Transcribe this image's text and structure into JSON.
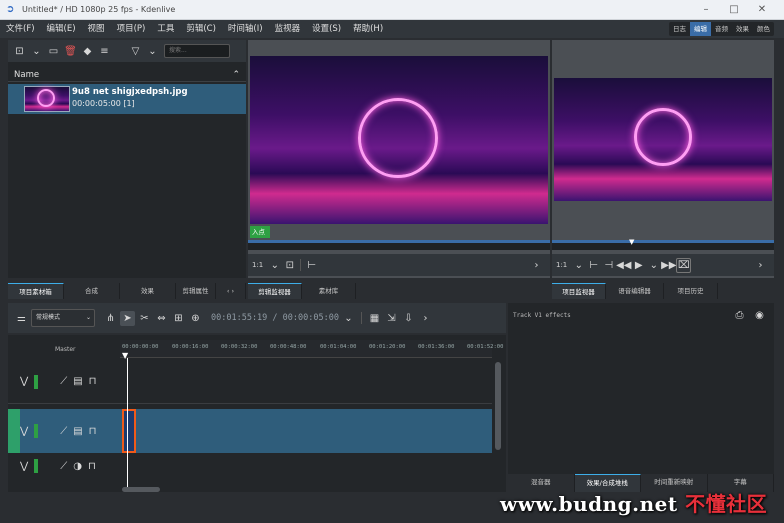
{
  "window": {
    "title": "Untitled* / HD 1080p 25 fps - Kdenlive",
    "minimize": "–",
    "maximize": "□",
    "close": "✕"
  },
  "menu": [
    "文件(F)",
    "编辑(E)",
    "视图",
    "项目(P)",
    "工具",
    "剪辑(C)",
    "时间轴(I)",
    "监视器",
    "设置(S)",
    "帮助(H)"
  ],
  "layouts": [
    {
      "label": "日志",
      "active": false
    },
    {
      "label": "编辑",
      "active": true
    },
    {
      "label": "音频",
      "active": false
    },
    {
      "label": "效果",
      "active": false
    },
    {
      "label": "颜色",
      "active": false
    }
  ],
  "bin": {
    "search_placeholder": "搜索...",
    "column_header": "Name",
    "clip": {
      "name": "9u8 net shigjxedpsh.jpg",
      "info": "00:00:05:00 [1]"
    }
  },
  "bin_tabs": [
    {
      "label": "项目素材箱",
      "active": true
    },
    {
      "label": "合成",
      "active": false
    },
    {
      "label": "效果",
      "active": false
    },
    {
      "label": "剪辑属性",
      "active": false
    }
  ],
  "clip_monitor": {
    "in_point": "入点",
    "zoom": "1:1"
  },
  "mid_tabs": [
    {
      "label": "剪辑监视器",
      "active": true
    },
    {
      "label": "素材库",
      "active": false
    }
  ],
  "project_monitor": {
    "zoom": "1:1"
  },
  "right_tabs": [
    {
      "label": "项目监视器",
      "active": true
    },
    {
      "label": "语音编辑器",
      "active": false
    },
    {
      "label": "项目历史",
      "active": false
    }
  ],
  "timeline": {
    "mode": "常规模式",
    "timecode": "00:01:55:19 / 00:00:05:00",
    "master": "Master",
    "ticks": [
      "00:00:00:00",
      "00:00:16:00",
      "00:00:32:00",
      "00:00:48:00",
      "00:01:04:00",
      "00:01:20:00",
      "00:01:36:00",
      "00:01:52:00"
    ]
  },
  "effects": {
    "title": "Track V1 effects"
  },
  "effects_tabs": [
    {
      "label": "混音器",
      "active": false
    },
    {
      "label": "效果/合成堆栈",
      "active": true
    },
    {
      "label": "时间重新映射",
      "active": false
    },
    {
      "label": "字幕",
      "active": false
    }
  ],
  "watermark": {
    "site": "www.budng.net",
    "brand": "不懂社区"
  },
  "colors": {
    "accent": "#3daee9",
    "selection": "#2f5d7b",
    "track_active": "#3daee9",
    "playhead": "#ffffff",
    "clip_border": "#f05a1a"
  }
}
